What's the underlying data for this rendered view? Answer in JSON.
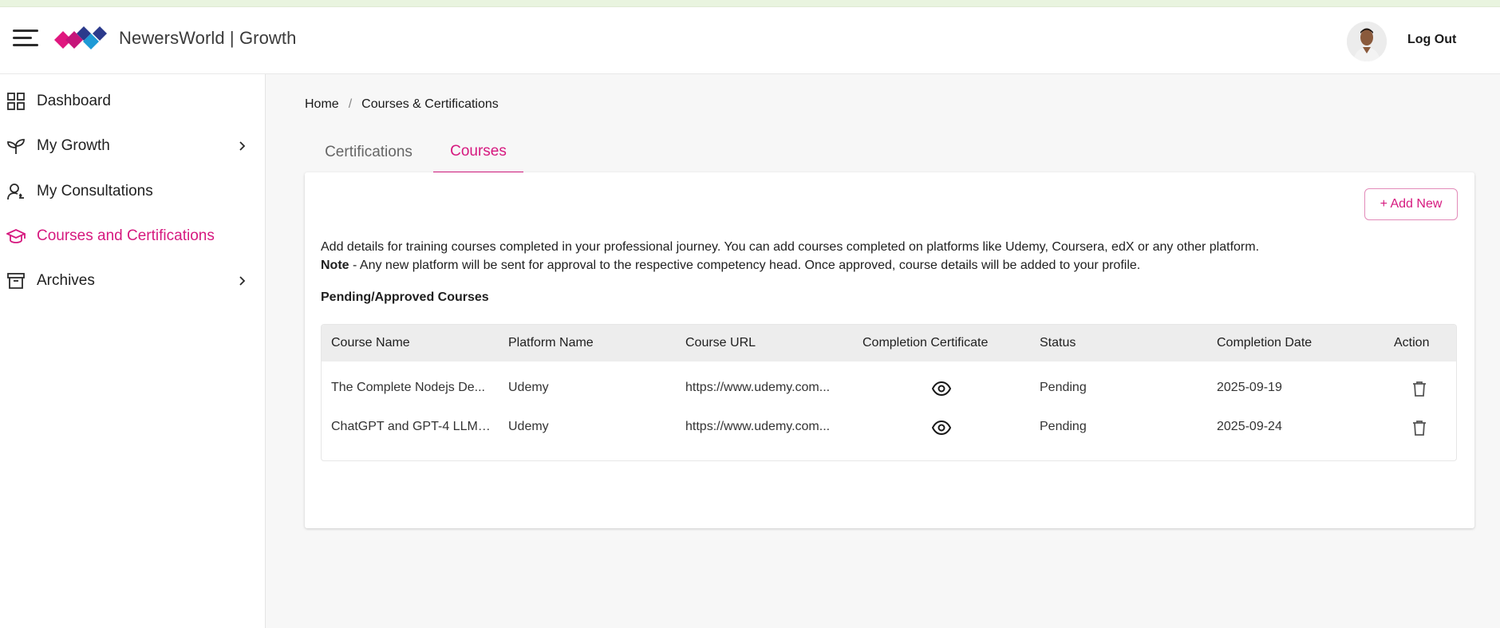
{
  "header": {
    "brand": "NewersWorld | Growth",
    "logout_label": "Log Out"
  },
  "sidebar": {
    "items": [
      {
        "label": "Dashboard",
        "icon": "dashboard-grid-icon",
        "has_chevron": false,
        "active": false
      },
      {
        "label": "My Growth",
        "icon": "sprout-icon",
        "has_chevron": true,
        "active": false
      },
      {
        "label": "My Consultations",
        "icon": "user-consult-icon",
        "has_chevron": false,
        "active": false
      },
      {
        "label": "Courses and Certifications",
        "icon": "graduation-cap-icon",
        "has_chevron": false,
        "active": true
      },
      {
        "label": "Archives",
        "icon": "archive-box-icon",
        "has_chevron": true,
        "active": false
      }
    ]
  },
  "breadcrumb": {
    "home": "Home",
    "separator": "/",
    "current": "Courses & Certifications"
  },
  "tabs": [
    {
      "label": "Certifications",
      "active": false
    },
    {
      "label": "Courses",
      "active": true
    }
  ],
  "card": {
    "add_new_label": "+ Add New",
    "description": "Add details for training courses completed in your professional journey. You can add courses completed on platforms like Udemy, Coursera, edX or any other platform.",
    "note_label": "Note",
    "note_text": " - Any new platform will be sent for approval to the respective competency head. Once approved, course details will be added to your profile.",
    "section_title": "Pending/Approved Courses"
  },
  "table": {
    "columns": [
      "Course Name",
      "Platform Name",
      "Course URL",
      "Completion Certificate",
      "Status",
      "Completion Date",
      "Action"
    ],
    "rows": [
      {
        "course_name": "The Complete Nodejs De...",
        "platform": "Udemy",
        "url": "https://www.udemy.com...",
        "status": "Pending",
        "date": "2025-09-19"
      },
      {
        "course_name": "ChatGPT and GPT-4 LLM ...",
        "platform": "Udemy",
        "url": "https://www.udemy.com...",
        "status": "Pending",
        "date": "2025-09-24"
      }
    ]
  },
  "colors": {
    "accent": "#d6197f",
    "logo_pink": "#e0177f",
    "logo_navy": "#2b3a8c",
    "logo_blue": "#1e9ad6"
  }
}
